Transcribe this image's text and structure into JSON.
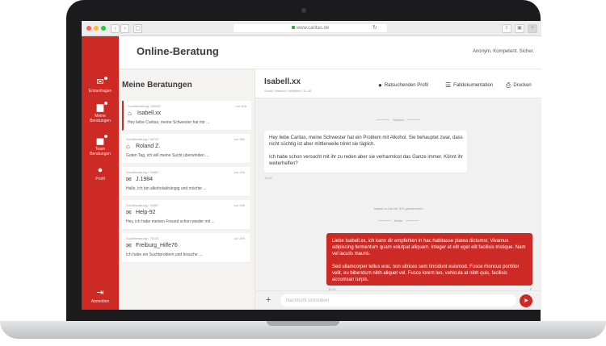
{
  "browser": {
    "url": "www.caritas.de",
    "traffic_colors": [
      "#fe5f57",
      "#febc2e",
      "#28c840"
    ]
  },
  "colors": {
    "accent": "#cd2a26",
    "panel_bg": "#f4f3f2"
  },
  "header": {
    "title": "Online-Beratung",
    "tagline": "Anonym. Kompetent. Sicher."
  },
  "sidebar": {
    "items": [
      {
        "label": "Erstanfragen",
        "icon": "envelope-icon",
        "glyph": "✉"
      },
      {
        "label": "Meine Beratungen",
        "icon": "chat-icon",
        "glyph": "▆"
      },
      {
        "label": "Team Beratungen",
        "icon": "team-icon",
        "glyph": "▅"
      },
      {
        "label": "Profil",
        "icon": "user-icon",
        "glyph": "●"
      }
    ],
    "logout": {
      "label": "Abmelden",
      "icon": "logout-icon",
      "glyph": "⇥"
    }
  },
  "list": {
    "heading": "Meine Beratungen",
    "items": [
      {
        "meta": "Suchtberatung / 80053",
        "time": "vor 40h",
        "name": "Isabell.xx",
        "icon": "house-icon",
        "glyph": "⌂",
        "snippet": "Hey liebe Caritas, meine Schwester hat mir ..."
      },
      {
        "meta": "Suchtberatung / 48729",
        "time": "vor 38h",
        "name": "Roland Z.",
        "icon": "house-icon",
        "glyph": "⌂",
        "snippet": "Guten Tag, ich will meine Sucht überwinden ..."
      },
      {
        "meta": "Suchtberatung / 34887",
        "time": "vor 19h",
        "name": "J.1984",
        "icon": "envelope-icon",
        "glyph": "✉",
        "snippet": "Hallo, ich bin alkoholabhängig und möchte ..."
      },
      {
        "meta": "Suchtberatung / 34587",
        "time": "vor 19h",
        "name": "Help-92",
        "icon": "envelope-icon",
        "glyph": "✉",
        "snippet": "Hey, ich habe meinen Freund schon wieder mit ..."
      },
      {
        "meta": "Suchtberatung / 79124",
        "time": "vor 20h",
        "name": "Freiburg_Hilfe76",
        "icon": "envelope-icon",
        "glyph": "✉",
        "snippet": "Ich habe ein Suchtproblem und brauche ..."
      }
    ]
  },
  "chat": {
    "name": "Isabell.xx",
    "subtitle": "Sucht / Alkohol / Weiblich / 31-40",
    "actions": {
      "profile": "Ratsuchenden Profil",
      "docs": "Falldokumentation",
      "print": "Drucken"
    },
    "day1": "Gestern",
    "incoming": {
      "p1": "Hey liebe Caritas, meine Schwester hat ein Problem mit Alkohol. Sie behauptet zwar, dass nicht süchtig ist aber mittlerweile trinkt sie täglich.",
      "p2": "Ich habe schon versucht mit ihr zu reden aber sie verharmlost das Ganze immer. Könnt ihr weiterhelfen?",
      "time": "11:02"
    },
    "system": "Isabell.xx hat mir 37h geschrieben",
    "day2": "Heute",
    "outgoing": {
      "p1": "Liebe Isabell.xx, ich kann dir empfehlen in hac habitasse platea dictumst. Vivamus adipiscing fermentum quam volutpat aliquam. Integer et elit eget elit facilisis tristique. Nam vel iaculis mauris.",
      "p2": "Sed ullamcorper tellus erat, non ultrices sem tincidunt euismod. Fusce rhoncus porttitor velit, eu bibendum nibh aliquet vel. Fusce lorem leo, vehicula at nibh quis, facilisis accumsan turpis.",
      "time": "11:02"
    },
    "input_placeholder": "Nachricht schreiben"
  }
}
